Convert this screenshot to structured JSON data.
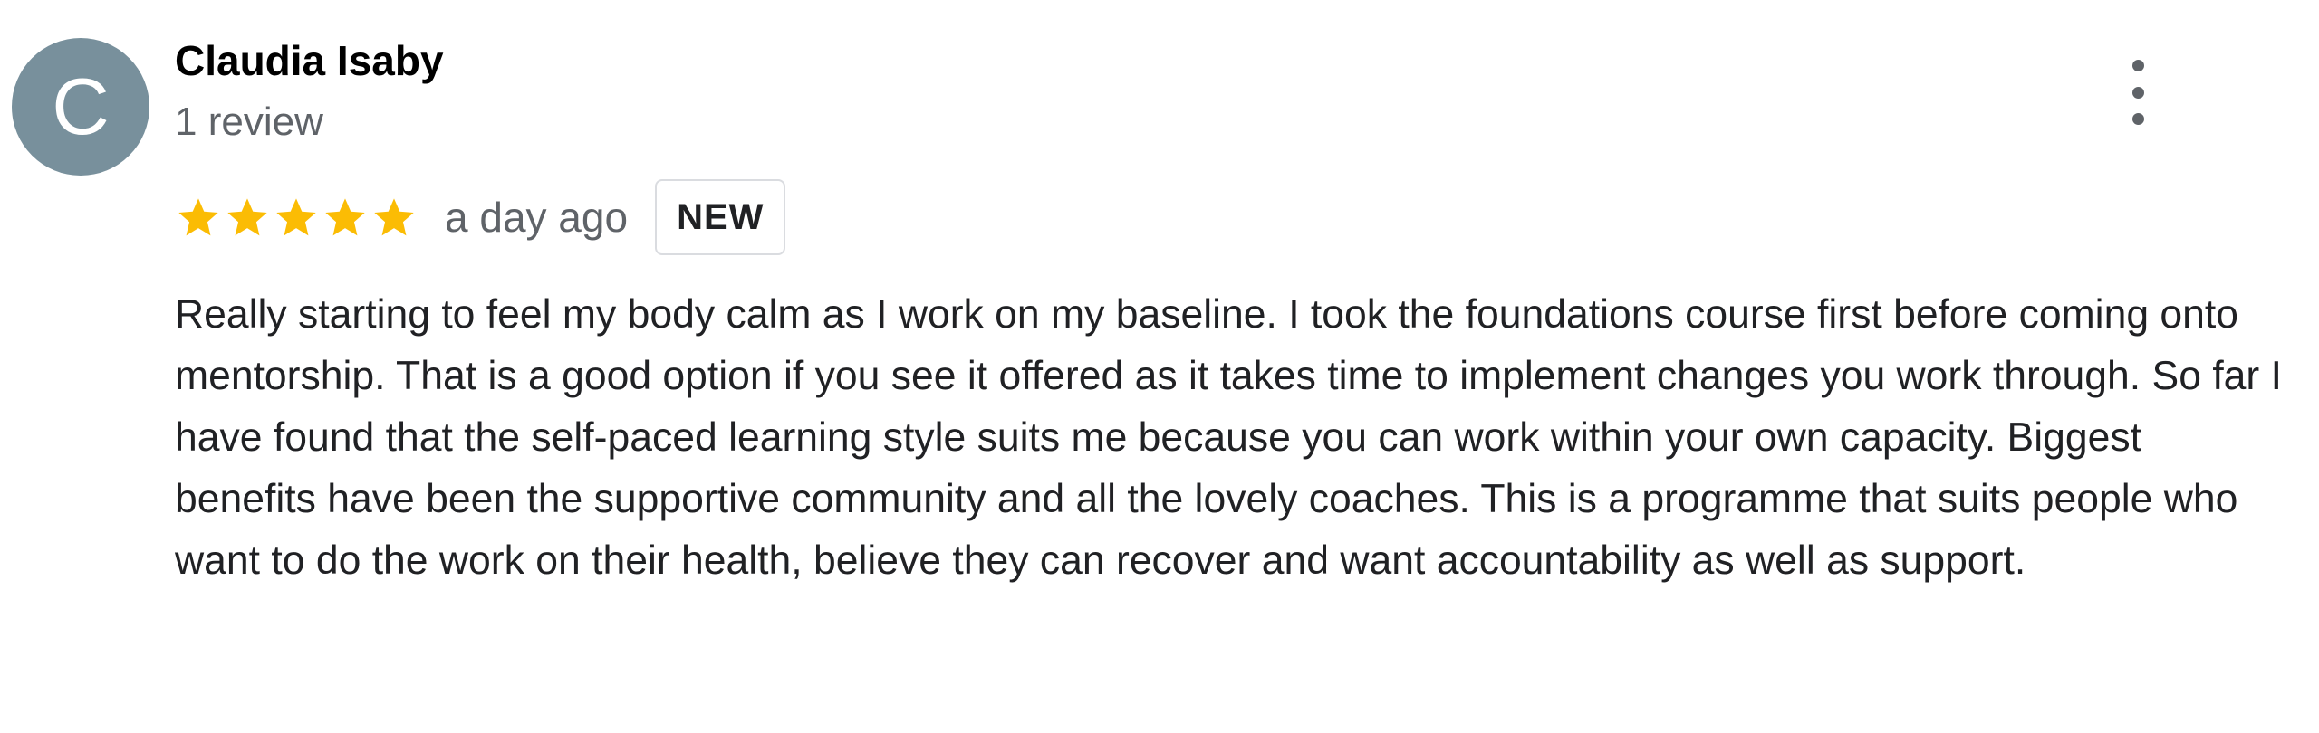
{
  "reviewer": {
    "avatar_letter": "C",
    "avatar_color": "#78909c",
    "name": "Claudia Isaby",
    "review_count": "1 review"
  },
  "menu": {
    "icon": "more-vert-icon"
  },
  "rating": {
    "stars": 5,
    "max_stars": 5,
    "star_color": "#fbbc04",
    "date": "a day ago",
    "badge": "NEW"
  },
  "review": {
    "text": "Really starting to feel my body calm as I work on my baseline. I took the foundations course first before coming onto mentorship. That is a good option if you see it offered as it takes time to implement changes you work through. So far I have found that the self-paced learning style suits me because you can work within your own capacity. Biggest benefits have been the supportive community and all the lovely coaches. This is a programme that suits people who want to do the work on their health, believe they can recover and want accountability as well as support."
  }
}
